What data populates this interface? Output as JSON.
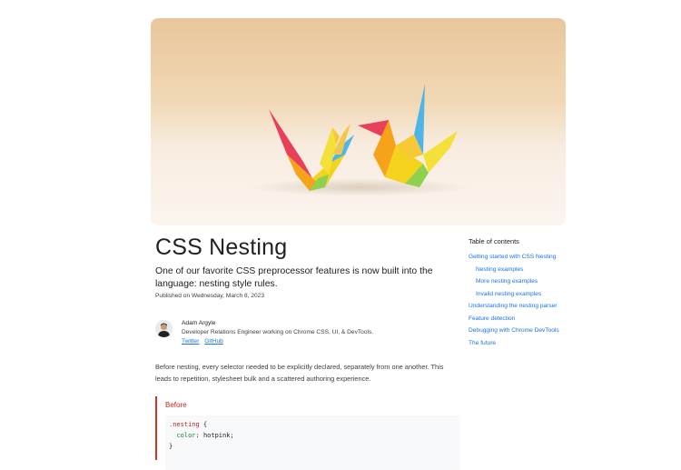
{
  "article": {
    "title": "CSS Nesting",
    "subtitle": "One of our favorite CSS preprocessor features is now built into the language: nesting style rules.",
    "published": "Published on Wednesday, March 8, 2023",
    "intro": "Before nesting, every selector needed to be explicitly declared, separately from one another. This leads to repetition, stylesheet bulk and a scattered authoring experience."
  },
  "author": {
    "name": "Adam Argyle",
    "bio": "Developer Relations Engineer working on Chrome CSS, UI, & DevTools.",
    "links": [
      "Twitter",
      "GitHub"
    ]
  },
  "before": {
    "label": "Before",
    "code": {
      "selector": ".nesting",
      "brace_open": " {",
      "property": "color",
      "colon": ": ",
      "value": "hotpink;",
      "brace_close": "}"
    }
  },
  "toc": {
    "title": "Table of contents",
    "items": [
      "Getting started with CSS Nesting",
      "Nesting examples",
      "More nesting examples",
      "Invalid nesting examples",
      "Understanding the nesting parser",
      "Feature detection",
      "Debugging with Chrome DevTools",
      "The future"
    ]
  },
  "colors": {
    "link": "#1a73e8",
    "before_accent": "#d93025",
    "text": "#202124"
  }
}
